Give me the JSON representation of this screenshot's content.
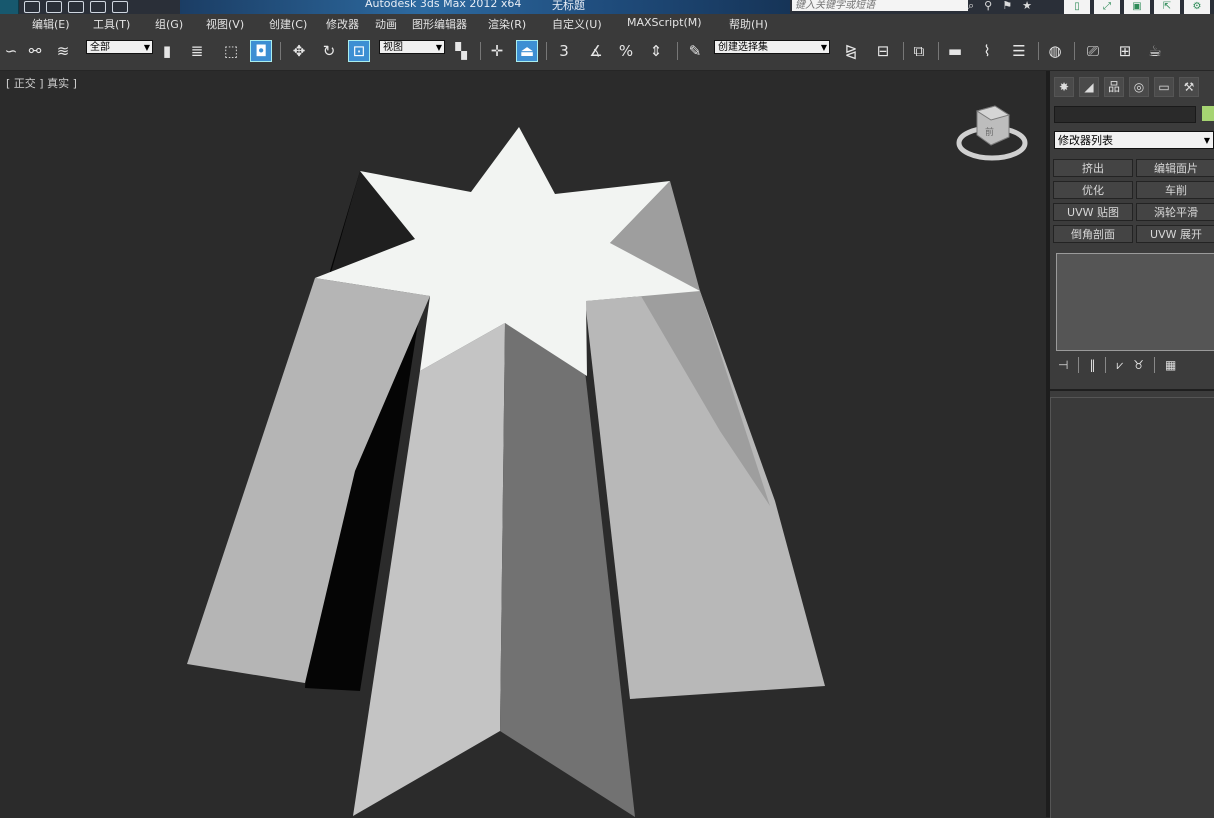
{
  "title_bar": {
    "app_title": "Autodesk 3ds Max  2012 x64",
    "file_title": "无标题",
    "search_placeholder": "键入关键字或短语",
    "icons": [
      "binoculars-icon",
      "user-icon",
      "bookmark-icon",
      "star-icon"
    ]
  },
  "menu": {
    "items": [
      "编辑(E)",
      "工具(T)",
      "组(G)",
      "视图(V)",
      "创建(C)",
      "修改器",
      "动画",
      "图形编辑器",
      "渲染(R)",
      "自定义(U)",
      "MAXScript(M)",
      "帮助(H)"
    ]
  },
  "toolbar": {
    "selection_filter": "全部",
    "reference_coord": "视图",
    "named_selection": "创建选择集",
    "snap_labels": [
      "3",
      "%"
    ]
  },
  "viewport": {
    "label": "[ 正交 ] 真实 ]",
    "viewcube_face": "前"
  },
  "command_panel": {
    "modifier_list": "修改器列表",
    "color_swatch": "#a6d472",
    "modifier_buttons": [
      [
        "挤出",
        "编辑面片"
      ],
      [
        "优化",
        "车削"
      ],
      [
        "UVW 贴图",
        "涡轮平滑"
      ],
      [
        "倒角剖面",
        "UVW 展开"
      ]
    ]
  }
}
